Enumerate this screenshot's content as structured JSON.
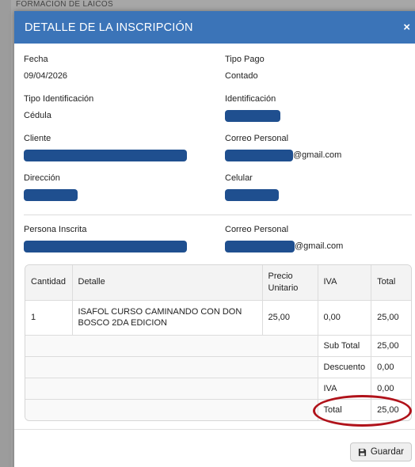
{
  "background": {
    "top_text": "FORMACION DE LAICOS"
  },
  "modal": {
    "title": "DETALLE DE LA INSCRIPCIÓN",
    "close_label": "×",
    "fields": {
      "fecha_label": "Fecha",
      "fecha_value": "09/04/2026",
      "tipo_pago_label": "Tipo Pago",
      "tipo_pago_value": "Contado",
      "tipo_id_label": "Tipo Identificación",
      "tipo_id_value": "Cédula",
      "identificacion_label": "Identificación",
      "cliente_label": "Cliente",
      "correo1_label": "Correo Personal",
      "correo1_suffix": "@gmail.com",
      "direccion_label": "Dirección",
      "celular_label": "Celular",
      "persona_label": "Persona Inscrita",
      "correo2_label": "Correo Personal",
      "correo2_suffix": "@gmail.com"
    },
    "table": {
      "headers": [
        "Cantidad",
        "Detalle",
        "Precio Unitario",
        "IVA",
        "Total"
      ],
      "rows": [
        {
          "cantidad": "1",
          "detalle": "ISAFOL CURSO CAMINANDO CON DON BOSCO 2DA EDICION",
          "precio": "25,00",
          "iva": "0,00",
          "total": "25,00"
        }
      ],
      "summary": [
        {
          "label": "Sub Total",
          "value": "25,00"
        },
        {
          "label": "Descuento",
          "value": "0,00"
        },
        {
          "label": "IVA",
          "value": "0,00"
        },
        {
          "label": "Total",
          "value": "25,00"
        }
      ]
    },
    "footer": {
      "save_label": "Guardar"
    }
  },
  "colors": {
    "header": "#3b74b8",
    "redaction": "#1f4f8f",
    "annotation": "#b0121a"
  }
}
